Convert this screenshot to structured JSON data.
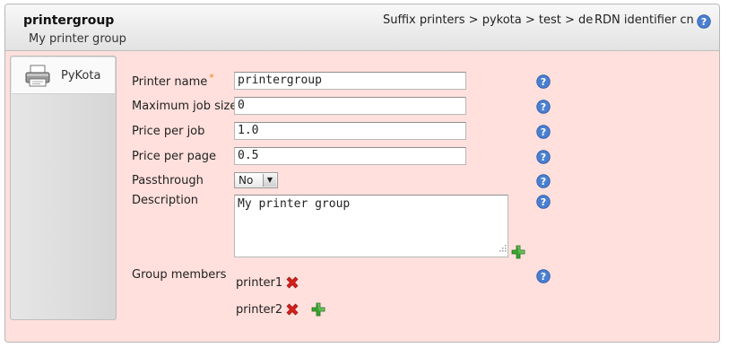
{
  "header": {
    "title": "printergroup",
    "subtitle": "My printer group",
    "breadcrumb": "Suffix printers > pykota > test > de",
    "rdn": "RDN identifier  cn"
  },
  "tabs": [
    {
      "label": "PyKota",
      "icon": "printer-icon"
    }
  ],
  "fields": {
    "printer_name": {
      "label": "Printer name",
      "required_mark": "*",
      "value": "printergroup"
    },
    "max_job_size": {
      "label": "Maximum job size",
      "value": "0"
    },
    "price_per_job": {
      "label": "Price per job",
      "value": "1.0"
    },
    "price_per_page": {
      "label": "Price per page",
      "value": "0.5"
    },
    "passthrough": {
      "label": "Passthrough",
      "value": "No"
    },
    "description": {
      "label": "Description",
      "value": "My printer group"
    },
    "group_members": {
      "label": "Group members",
      "members": [
        "printer1",
        "printer2"
      ]
    }
  },
  "icons": {
    "help": "help-icon",
    "remove": "remove-icon",
    "add": "add-icon"
  },
  "colors": {
    "panel_bg": "#ffe0dc",
    "help_blue": "#4a7fd1",
    "remove_red": "#d8201b",
    "add_green": "#3aa52f",
    "required": "#e8821e"
  }
}
